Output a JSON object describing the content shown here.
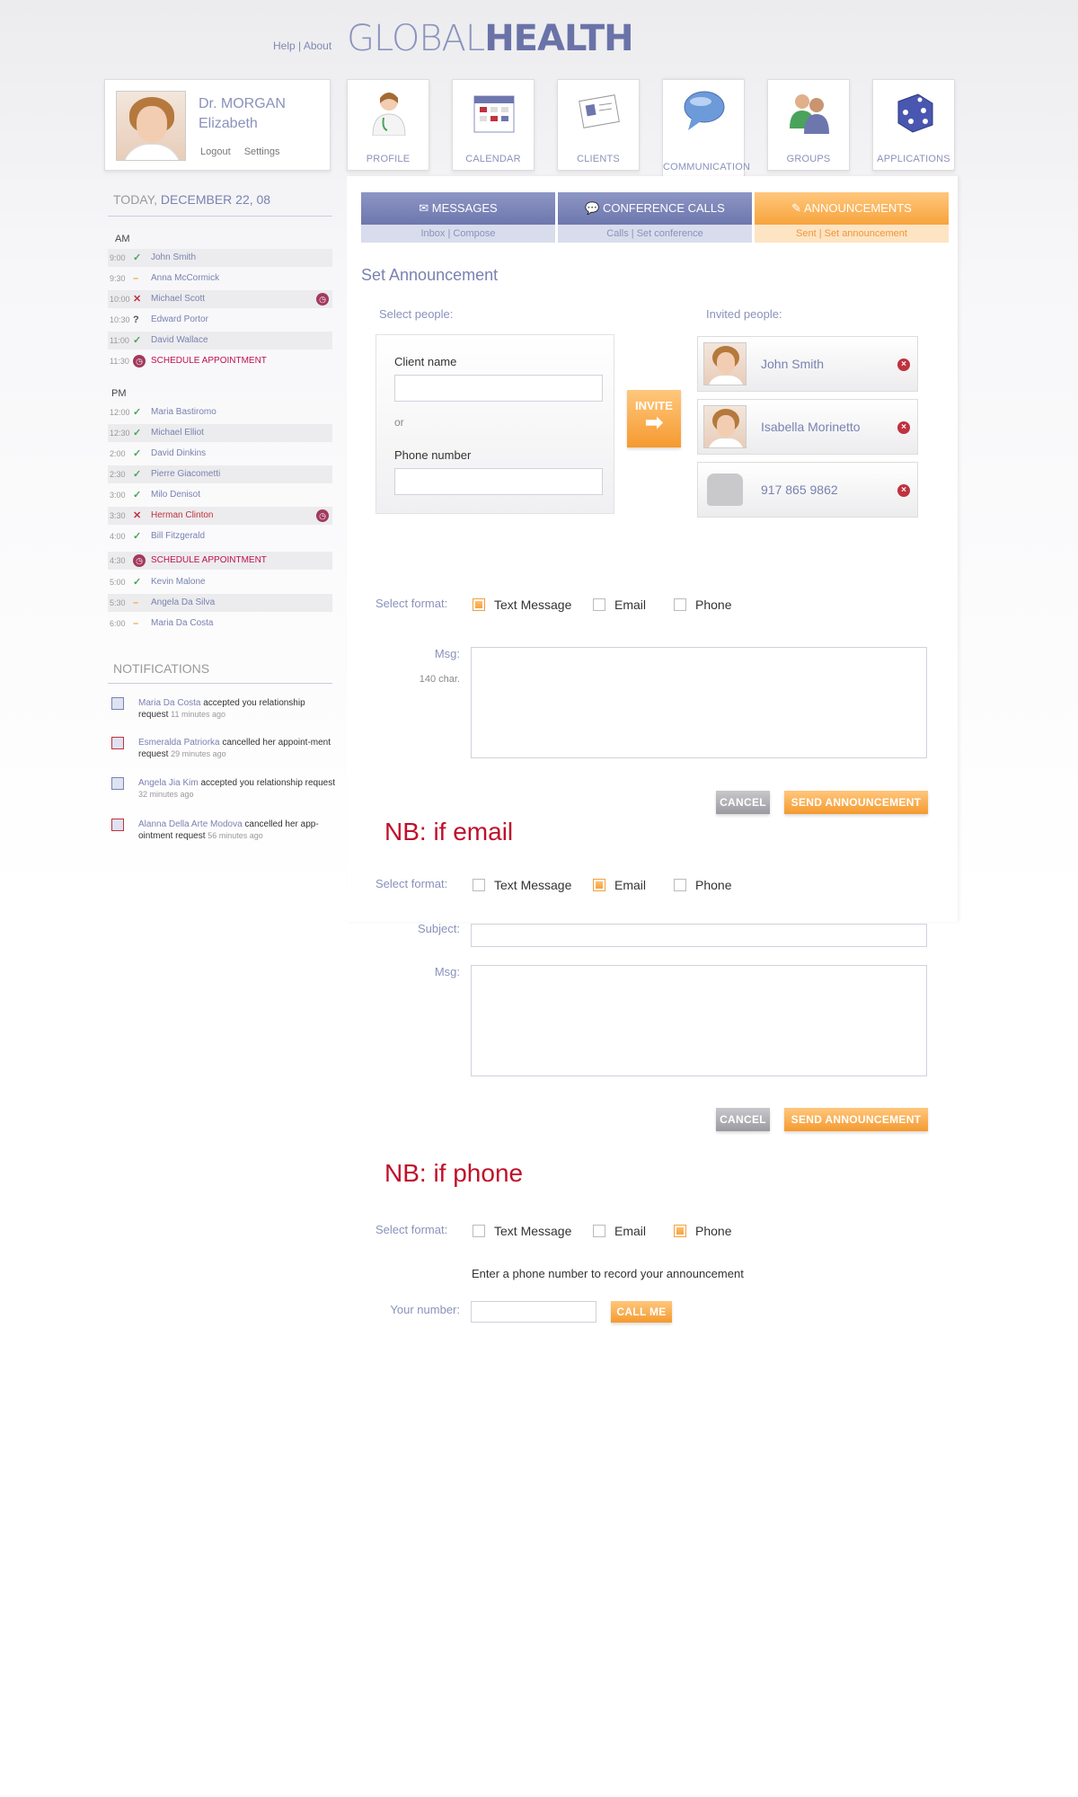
{
  "header": {
    "help": "Help",
    "sep": "|",
    "about": "About",
    "logo_light": "GLOBAL",
    "logo_bold": "HEALTH"
  },
  "profile": {
    "title": "Dr. MORGAN",
    "first_name": "Elizabeth",
    "logout": "Logout",
    "settings": "Settings"
  },
  "nav": [
    {
      "label": "PROFILE"
    },
    {
      "label": "CALENDAR"
    },
    {
      "label": "CLIENTS"
    },
    {
      "label": "COMMUNICATION"
    },
    {
      "label": "GROUPS"
    },
    {
      "label": "APPLICATIONS"
    }
  ],
  "sidebar": {
    "today_prefix": "TODAY,",
    "today_date": "DECEMBER 22, 08",
    "am": "AM",
    "pm": "PM",
    "am_appts": [
      {
        "time": "9:00",
        "status": "✓",
        "name": "John Smith"
      },
      {
        "time": "9:30",
        "status": "–",
        "name": "Anna McCormick"
      },
      {
        "time": "10:00",
        "status": "✕",
        "name": "Michael Scott"
      },
      {
        "time": "10:30",
        "status": "?",
        "name": "Edward Portor"
      },
      {
        "time": "11:00",
        "status": "✓",
        "name": "David Wallace"
      },
      {
        "time": "11:30",
        "status": "",
        "name": "SCHEDULE APPOINTMENT"
      }
    ],
    "pm_appts": [
      {
        "time": "12:00",
        "status": "✓",
        "name": "Maria Bastiromo"
      },
      {
        "time": "12:30",
        "status": "✓",
        "name": "Michael Elliot"
      },
      {
        "time": "2:00",
        "status": "✓",
        "name": "David Dinkins"
      },
      {
        "time": "2:30",
        "status": "✓",
        "name": "Pierre Giacometti"
      },
      {
        "time": "3:00",
        "status": "✓",
        "name": "Milo Denisot"
      },
      {
        "time": "3:30",
        "status": "✕",
        "name": "Herman Clinton"
      },
      {
        "time": "4:00",
        "status": "✓",
        "name": "Bill Fitzgerald"
      },
      {
        "time": "4:30",
        "status": "",
        "name": "SCHEDULE APPOINTMENT"
      },
      {
        "time": "5:00",
        "status": "✓",
        "name": "Kevin Malone"
      },
      {
        "time": "5:30",
        "status": "–",
        "name": "Angela Da Silva"
      },
      {
        "time": "6:00",
        "status": "–",
        "name": "Maria Da Costa"
      }
    ],
    "notifications_title": "NOTIFICATIONS",
    "notifications": [
      {
        "who": "Maria Da Costa",
        "text": " accepted you relationship request ",
        "ago": "11 minutes ago"
      },
      {
        "who": "Esmeralda Patriorka",
        "text": " cancelled her appoint-ment request ",
        "ago": "29 minutes ago"
      },
      {
        "who": "Angela Jia Kim",
        "text": " accepted you relationship request ",
        "ago": "32 minutes ago"
      },
      {
        "who": "Alanna Della Arte Modova",
        "text": " cancelled her app-ointment request ",
        "ago": "56 minutes ago"
      }
    ]
  },
  "subtabs": [
    {
      "label": "MESSAGES",
      "link1": "Inbox",
      "link2": "Compose"
    },
    {
      "label": "CONFERENCE CALLS",
      "link1": "Calls",
      "link2": "Set conference"
    },
    {
      "label": "ANNOUNCEMENTS",
      "link1": "Sent",
      "link2": "Set announcement"
    }
  ],
  "form": {
    "title": "Set Announcement",
    "select_people": "Select people:",
    "invited_people": "Invited people:",
    "client_name": "Client name",
    "or": "or",
    "phone_number": "Phone number",
    "invite": "INVITE",
    "invited": [
      {
        "name": "John Smith"
      },
      {
        "name": "Isabella Morinetto"
      },
      {
        "name": "917 865 9862"
      }
    ],
    "select_format": "Select format:",
    "fmt_text": "Text Message",
    "fmt_email": "Email",
    "fmt_phone": "Phone",
    "msg": "Msg:",
    "char_limit": "140 char.",
    "subject": "Subject:",
    "cancel": "CANCEL",
    "send": "SEND ANNOUNCEMENT",
    "nb_email": "NB: if email",
    "nb_phone": "NB: if phone",
    "enter_phone": "Enter a phone number to record your announcement",
    "your_number": "Your number:",
    "call_me": "CALL ME"
  },
  "colors": {
    "accent_blue": "#7a82b0",
    "accent_orange": "#f7a43d",
    "note_red": "#c0102a"
  }
}
